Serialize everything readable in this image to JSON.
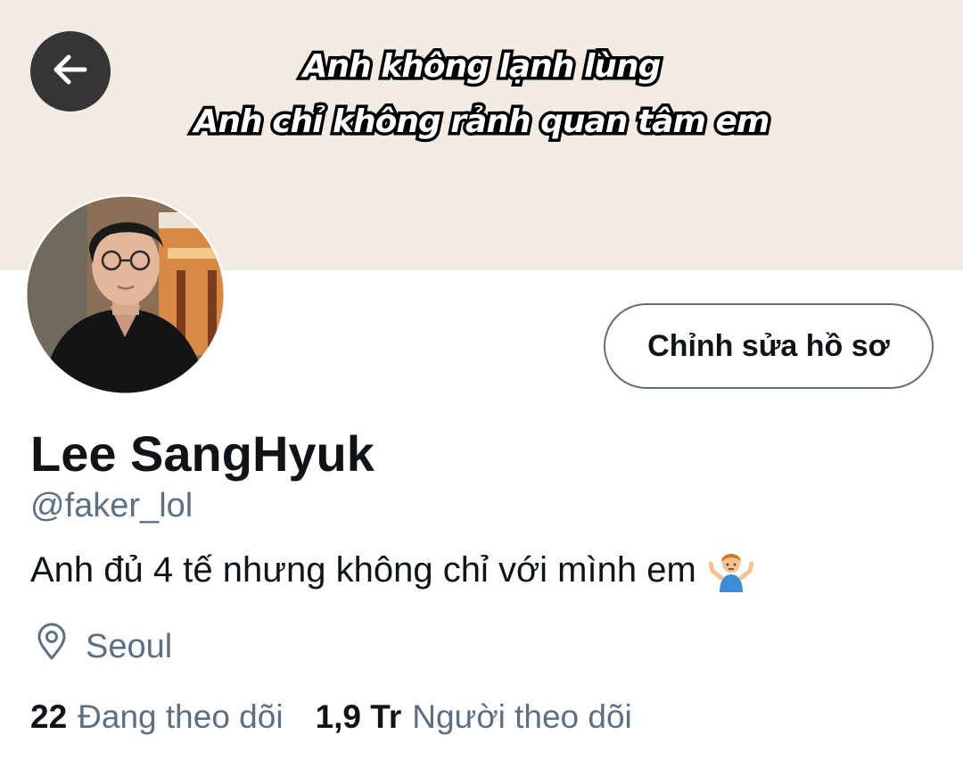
{
  "banner": {
    "line1": "Anh không lạnh lùng",
    "line2": "Anh chỉ không rảnh quan tâm em"
  },
  "nav": {
    "back_icon": "arrow-left-icon"
  },
  "profile": {
    "edit_button_label": "Chỉnh sửa hồ sơ",
    "display_name": "Lee SangHyuk",
    "handle": "@faker_lol",
    "bio": "Anh đủ 4 tế nhưng không chỉ với mình em",
    "bio_emoji": "person-shrugging-emoji",
    "location_icon": "location-pin-icon",
    "location": "Seoul",
    "following_count": "22",
    "following_label": "Đang theo dõi",
    "followers_count": "1,9 Tr",
    "followers_label": "Người theo dõi"
  },
  "colors": {
    "banner_bg": "#f1ebe3",
    "text_primary": "#0f1419",
    "text_secondary": "#5b7083",
    "back_button_bg": "#353535"
  }
}
